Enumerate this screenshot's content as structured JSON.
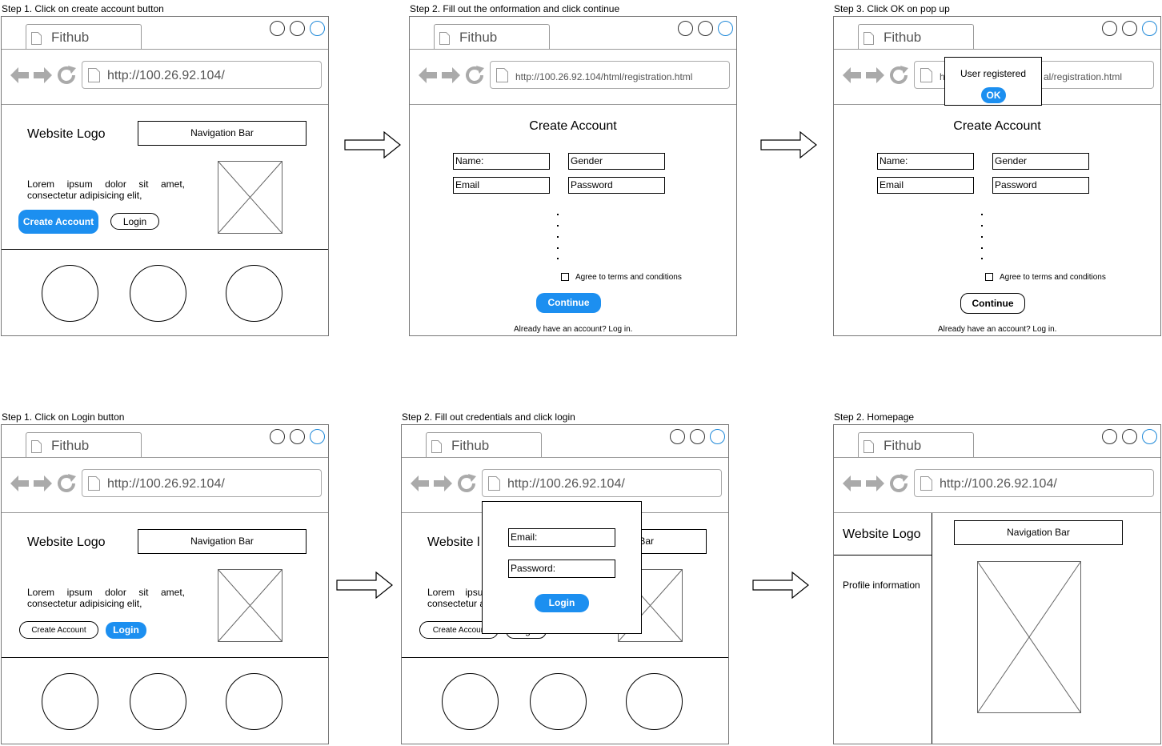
{
  "steps": [
    {
      "title": "Step 1. Click on create account button"
    },
    {
      "title": "Step 2. Fill out the onformation and click continue"
    },
    {
      "title": "Step 3. Click OK on pop up"
    },
    {
      "title": "Step 1. Click on Login button"
    },
    {
      "title": "Step 2. Fill out credentials and click login"
    },
    {
      "title": "Step 2. Homepage"
    }
  ],
  "browser": {
    "tab_name": "Fithub"
  },
  "urls": {
    "home": "http://100.26.92.104/",
    "registration": "http://100.26.92.104/html/registration.html",
    "registration_partial_left": "h",
    "registration_partial_right": "al/registration.html"
  },
  "landing": {
    "logo": "Website Logo",
    "nav": "Navigation Bar",
    "lorem": "Lorem ipsum dolor sit amet, consectetur adipisicing elit,",
    "create_account": "Create Account",
    "login": "Login"
  },
  "registration": {
    "title": "Create Account",
    "name": "Name:",
    "gender": "Gender",
    "email": "Email",
    "password": "Password",
    "terms": "Agree to terms and conditions",
    "continue": "Continue",
    "already": "Already have an account? Log in."
  },
  "popup_registered": {
    "message": "User registered",
    "ok": "OK"
  },
  "login_popup": {
    "email": "Email:",
    "password": "Password:",
    "login": "Login",
    "partial_logo": "Website l",
    "partial_nav": "Bar",
    "partial_lorem": "Lorem    ipsu",
    "partial_lorem2": "consectetur a",
    "partial_create": "Create Accoun",
    "partial_login": "Login"
  },
  "homepage": {
    "logo": "Website Logo",
    "profile": "Profile information",
    "nav": "Navigation Bar"
  },
  "colors": {
    "accent": "#1c8ff0",
    "window_blue": "#1e88d8"
  }
}
